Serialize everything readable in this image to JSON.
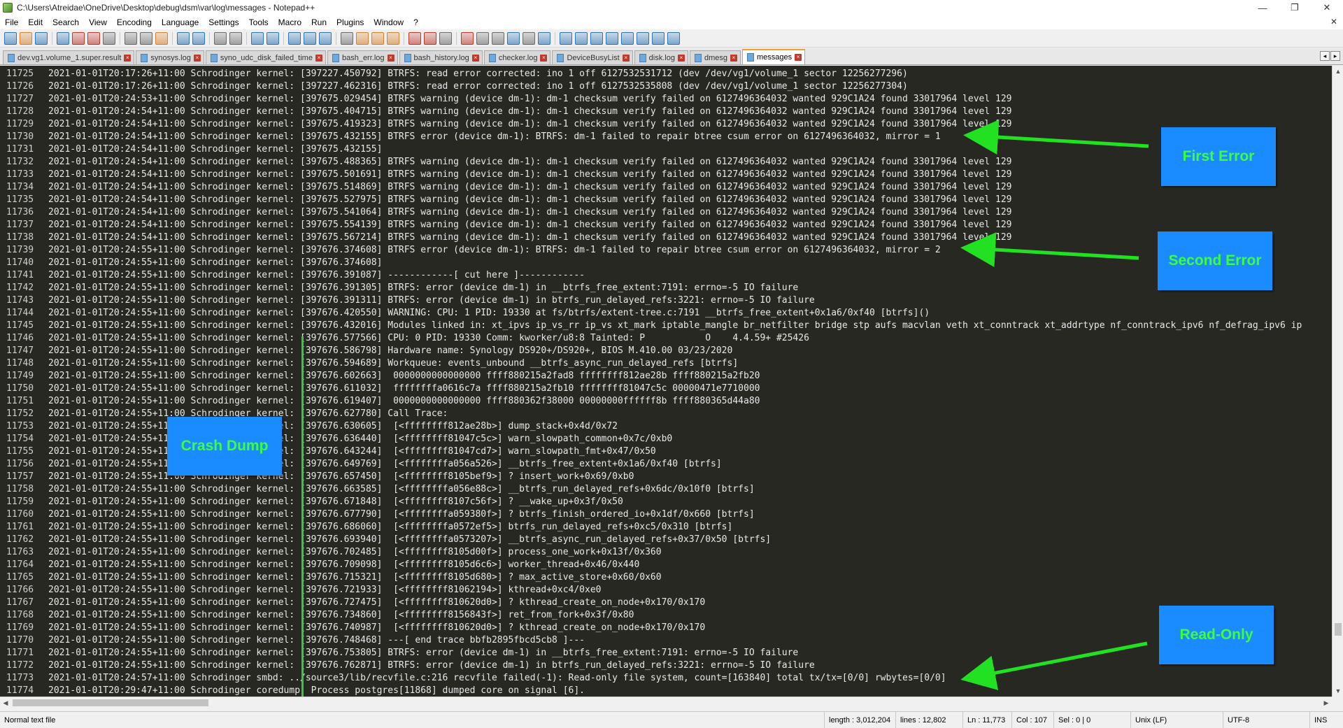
{
  "window": {
    "title": "C:\\Users\\Atreidae\\OneDrive\\Desktop\\debug\\dsm\\var\\log\\messages - Notepad++",
    "minimize": "—",
    "restore": "❐",
    "close": "✕"
  },
  "menu": {
    "items": [
      "File",
      "Edit",
      "Search",
      "View",
      "Encoding",
      "Language",
      "Settings",
      "Tools",
      "Macro",
      "Run",
      "Plugins",
      "Window",
      "?"
    ],
    "close_glyph": "✕"
  },
  "toolbar": {
    "icons": [
      "new-file",
      "open-file",
      "save",
      "save-all",
      "close",
      "close-all",
      "print",
      "cut",
      "copy",
      "paste",
      "undo",
      "redo",
      "find",
      "replace",
      "zoom-in",
      "zoom-out",
      "sync-vertical",
      "sync-horizontal",
      "word-wrap",
      "show-all-chars",
      "indent-guide",
      "udl",
      "doc-map",
      "function-list",
      "folder-as-workspace",
      "monitor",
      "record-macro",
      "stop-record",
      "play-macro",
      "run-macro-multiple",
      "save-macro",
      "launch-browser",
      "b1",
      "b2",
      "b3",
      "b4",
      "b5",
      "b6",
      "b7",
      "b8"
    ],
    "colors": {
      "primary": "#2e75b6",
      "warn": "#d9822b",
      "red": "#c0392b",
      "green": "#3a9d3a",
      "grey": "#6b6b6b"
    }
  },
  "tabs": [
    {
      "label": "dev.vg1.volume_1.super.result",
      "active": false
    },
    {
      "label": "synosys.log",
      "active": false
    },
    {
      "label": "syno_udc_disk_failed_time",
      "active": false
    },
    {
      "label": "bash_err.log",
      "active": false
    },
    {
      "label": "bash_history.log",
      "active": false
    },
    {
      "label": "checker.log",
      "active": false
    },
    {
      "label": "DeviceBusyList",
      "active": false
    },
    {
      "label": "disk.log",
      "active": false
    },
    {
      "label": "dmesg",
      "active": false
    },
    {
      "label": "messages",
      "active": true
    }
  ],
  "tab_scroll": {
    "left": "◂",
    "right": "▸"
  },
  "editor": {
    "lines": [
      {
        "num": "11725",
        "text": "2021-01-01T20:17:26+11:00 Schrodinger kernel: [397227.450792] BTRFS: read error corrected: ino 1 off 6127532531712 (dev /dev/vg1/volume_1 sector 12256277296)"
      },
      {
        "num": "11726",
        "text": "2021-01-01T20:17:26+11:00 Schrodinger kernel: [397227.462316] BTRFS: read error corrected: ino 1 off 6127532535808 (dev /dev/vg1/volume_1 sector 12256277304)"
      },
      {
        "num": "11727",
        "text": "2021-01-01T20:24:53+11:00 Schrodinger kernel: [397675.029454] BTRFS warning (device dm-1): dm-1 checksum verify failed on 6127496364032 wanted 929C1A24 found 33017964 level 129"
      },
      {
        "num": "11728",
        "text": "2021-01-01T20:24:54+11:00 Schrodinger kernel: [397675.404715] BTRFS warning (device dm-1): dm-1 checksum verify failed on 6127496364032 wanted 929C1A24 found 33017964 level 129"
      },
      {
        "num": "11729",
        "text": "2021-01-01T20:24:54+11:00 Schrodinger kernel: [397675.419323] BTRFS warning (device dm-1): dm-1 checksum verify failed on 6127496364032 wanted 929C1A24 found 33017964 level 129"
      },
      {
        "num": "11730",
        "text": "2021-01-01T20:24:54+11:00 Schrodinger kernel: [397675.432155] BTRFS error (device dm-1): BTRFS: dm-1 failed to repair btree csum error on 6127496364032, mirror = 1"
      },
      {
        "num": "11731",
        "text": "2021-01-01T20:24:54+11:00 Schrodinger kernel: [397675.432155]"
      },
      {
        "num": "11732",
        "text": "2021-01-01T20:24:54+11:00 Schrodinger kernel: [397675.488365] BTRFS warning (device dm-1): dm-1 checksum verify failed on 6127496364032 wanted 929C1A24 found 33017964 level 129"
      },
      {
        "num": "11733",
        "text": "2021-01-01T20:24:54+11:00 Schrodinger kernel: [397675.501691] BTRFS warning (device dm-1): dm-1 checksum verify failed on 6127496364032 wanted 929C1A24 found 33017964 level 129"
      },
      {
        "num": "11734",
        "text": "2021-01-01T20:24:54+11:00 Schrodinger kernel: [397675.514869] BTRFS warning (device dm-1): dm-1 checksum verify failed on 6127496364032 wanted 929C1A24 found 33017964 level 129"
      },
      {
        "num": "11735",
        "text": "2021-01-01T20:24:54+11:00 Schrodinger kernel: [397675.527975] BTRFS warning (device dm-1): dm-1 checksum verify failed on 6127496364032 wanted 929C1A24 found 33017964 level 129"
      },
      {
        "num": "11736",
        "text": "2021-01-01T20:24:54+11:00 Schrodinger kernel: [397675.541064] BTRFS warning (device dm-1): dm-1 checksum verify failed on 6127496364032 wanted 929C1A24 found 33017964 level 129"
      },
      {
        "num": "11737",
        "text": "2021-01-01T20:24:54+11:00 Schrodinger kernel: [397675.554139] BTRFS warning (device dm-1): dm-1 checksum verify failed on 6127496364032 wanted 929C1A24 found 33017964 level 129"
      },
      {
        "num": "11738",
        "text": "2021-01-01T20:24:54+11:00 Schrodinger kernel: [397675.567214] BTRFS warning (device dm-1): dm-1 checksum verify failed on 6127496364032 wanted 929C1A24 found 33017964 level 129"
      },
      {
        "num": "11739",
        "text": "2021-01-01T20:24:55+11:00 Schrodinger kernel: [397676.374608] BTRFS error (device dm-1): BTRFS: dm-1 failed to repair btree csum error on 6127496364032, mirror = 2"
      },
      {
        "num": "11740",
        "text": "2021-01-01T20:24:55+11:00 Schrodinger kernel: [397676.374608]"
      },
      {
        "num": "11741",
        "text": "2021-01-01T20:24:55+11:00 Schrodinger kernel: [397676.391087] ------------[ cut here ]------------"
      },
      {
        "num": "11742",
        "text": "2021-01-01T20:24:55+11:00 Schrodinger kernel: [397676.391305] BTRFS: error (device dm-1) in __btrfs_free_extent:7191: errno=-5 IO failure"
      },
      {
        "num": "11743",
        "text": "2021-01-01T20:24:55+11:00 Schrodinger kernel: [397676.391311] BTRFS: error (device dm-1) in btrfs_run_delayed_refs:3221: errno=-5 IO failure"
      },
      {
        "num": "11744",
        "text": "2021-01-01T20:24:55+11:00 Schrodinger kernel: [397676.420550] WARNING: CPU: 1 PID: 19330 at fs/btrfs/extent-tree.c:7191 __btrfs_free_extent+0x1a6/0xf40 [btrfs]()"
      },
      {
        "num": "11745",
        "text": "2021-01-01T20:24:55+11:00 Schrodinger kernel: [397676.432016] Modules linked in: xt_ipvs ip_vs_rr ip_vs xt_mark iptable_mangle br_netfilter bridge stp aufs macvlan veth xt_conntrack xt_addrtype nf_conntrack_ipv6 nf_defrag_ipv6 ip"
      },
      {
        "num": "11746",
        "text": "2021-01-01T20:24:55+11:00 Schrodinger kernel: [397676.577566] CPU: 0 PID: 19330 Comm: kworker/u8:8 Tainted: P           O    4.4.59+ #25426"
      },
      {
        "num": "11747",
        "text": "2021-01-01T20:24:55+11:00 Schrodinger kernel: [397676.586798] Hardware name: Synology DS920+/DS920+, BIOS M.410.00 03/23/2020"
      },
      {
        "num": "11748",
        "text": "2021-01-01T20:24:55+11:00 Schrodinger kernel: [397676.594689] Workqueue: events_unbound __btrfs_async_run_delayed_refs [btrfs]"
      },
      {
        "num": "11749",
        "text": "2021-01-01T20:24:55+11:00 Schrodinger kernel: [397676.602663]  0000000000000000 ffff880215a2fad8 ffffffff812ae28b ffff880215a2fb20"
      },
      {
        "num": "11750",
        "text": "2021-01-01T20:24:55+11:00 Schrodinger kernel: [397676.611032]  ffffffffa0616c7a ffff880215a2fb10 ffffffff81047c5c 00000471e7710000"
      },
      {
        "num": "11751",
        "text": "2021-01-01T20:24:55+11:00 Schrodinger kernel: [397676.619407]  0000000000000000 ffff880362f38000 00000000ffffff8b ffff880365d44a80"
      },
      {
        "num": "11752",
        "text": "2021-01-01T20:24:55+11:00 Schrodinger kernel: [397676.627780] Call Trace:"
      },
      {
        "num": "11753",
        "text": "2021-01-01T20:24:55+11:00 Schrodinger kernel: [397676.630605]  [<ffffffff812ae28b>] dump_stack+0x4d/0x72"
      },
      {
        "num": "11754",
        "text": "2021-01-01T20:24:55+11:00 Schrodinger kernel: [397676.636440]  [<ffffffff81047c5c>] warn_slowpath_common+0x7c/0xb0"
      },
      {
        "num": "11755",
        "text": "2021-01-01T20:24:55+11:00 Schrodinger kernel: [397676.643244]  [<ffffffff81047cd7>] warn_slowpath_fmt+0x47/0x50"
      },
      {
        "num": "11756",
        "text": "2021-01-01T20:24:55+11:00 Schrodinger kernel: [397676.649769]  [<ffffffffa056a526>] __btrfs_free_extent+0x1a6/0xf40 [btrfs]"
      },
      {
        "num": "11757",
        "text": "2021-01-01T20:24:55+11:00 Schrodinger kernel: [397676.657450]  [<ffffffff8105bef9>] ? insert_work+0x69/0xb0"
      },
      {
        "num": "11758",
        "text": "2021-01-01T20:24:55+11:00 Schrodinger kernel: [397676.663585]  [<ffffffffa056e88c>] __btrfs_run_delayed_refs+0x6dc/0x10f0 [btrfs]"
      },
      {
        "num": "11759",
        "text": "2021-01-01T20:24:55+11:00 Schrodinger kernel: [397676.671848]  [<ffffffff8107c56f>] ? __wake_up+0x3f/0x50"
      },
      {
        "num": "11760",
        "text": "2021-01-01T20:24:55+11:00 Schrodinger kernel: [397676.677790]  [<ffffffffa059380f>] ? btrfs_finish_ordered_io+0x1df/0x660 [btrfs]"
      },
      {
        "num": "11761",
        "text": "2021-01-01T20:24:55+11:00 Schrodinger kernel: [397676.686060]  [<ffffffffa0572ef5>] btrfs_run_delayed_refs+0xc5/0x310 [btrfs]"
      },
      {
        "num": "11762",
        "text": "2021-01-01T20:24:55+11:00 Schrodinger kernel: [397676.693940]  [<ffffffffa0573207>] __btrfs_async_run_delayed_refs+0x37/0x50 [btrfs]"
      },
      {
        "num": "11763",
        "text": "2021-01-01T20:24:55+11:00 Schrodinger kernel: [397676.702485]  [<ffffffff8105d00f>] process_one_work+0x13f/0x360"
      },
      {
        "num": "11764",
        "text": "2021-01-01T20:24:55+11:00 Schrodinger kernel: [397676.709098]  [<ffffffff8105d6c6>] worker_thread+0x46/0x440"
      },
      {
        "num": "11765",
        "text": "2021-01-01T20:24:55+11:00 Schrodinger kernel: [397676.715321]  [<ffffffff8105d680>] ? max_active_store+0x60/0x60"
      },
      {
        "num": "11766",
        "text": "2021-01-01T20:24:55+11:00 Schrodinger kernel: [397676.721933]  [<ffffffff81062194>] kthread+0xc4/0xe0"
      },
      {
        "num": "11767",
        "text": "2021-01-01T20:24:55+11:00 Schrodinger kernel: [397676.727475]  [<ffffffff810620d0>] ? kthread_create_on_node+0x170/0x170"
      },
      {
        "num": "11768",
        "text": "2021-01-01T20:24:55+11:00 Schrodinger kernel: [397676.734860]  [<ffffffff8156843f>] ret_from_fork+0x3f/0x80"
      },
      {
        "num": "11769",
        "text": "2021-01-01T20:24:55+11:00 Schrodinger kernel: [397676.740987]  [<ffffffff810620d0>] ? kthread_create_on_node+0x170/0x170"
      },
      {
        "num": "11770",
        "text": "2021-01-01T20:24:55+11:00 Schrodinger kernel: [397676.748468] ---[ end trace bbfb2895fbcd5cb8 ]---"
      },
      {
        "num": "11771",
        "text": "2021-01-01T20:24:55+11:00 Schrodinger kernel: [397676.753805] BTRFS: error (device dm-1) in __btrfs_free_extent:7191: errno=-5 IO failure"
      },
      {
        "num": "11772",
        "text": "2021-01-01T20:24:55+11:00 Schrodinger kernel: [397676.762871] BTRFS: error (device dm-1) in btrfs_run_delayed_refs:3221: errno=-5 IO failure"
      },
      {
        "num": "11773",
        "text": "2021-01-01T20:24:57+11:00 Schrodinger smbd: ../source3/lib/recvfile.c:216 recvfile failed(-1): Read-only file system, count=[163840] total tx/tx=[0/0] rwbytes=[0/0]"
      },
      {
        "num": "11774",
        "text": "2021-01-01T20:29:47+11:00 Schrodinger coredump: Process postgres[11868] dumped core on signal [6]."
      }
    ],
    "background": "#272822",
    "text_color": "#e8e8e8"
  },
  "annotations": [
    {
      "id": "first-error",
      "label": "First Error"
    },
    {
      "id": "second-error",
      "label": "Second Error"
    },
    {
      "id": "crash-dump",
      "label": "Crash Dump"
    },
    {
      "id": "read-only",
      "label": "Read-Only"
    }
  ],
  "annotation_colors": {
    "box": "#1a8cff",
    "text": "#3cff3c",
    "arrow": "#22e022"
  },
  "scrollbars": {
    "up": "▲",
    "down": "▼",
    "left": "◀",
    "right": "▶"
  },
  "status": {
    "file_type": "Normal text file",
    "length": "length : 3,012,204",
    "lines": "lines : 12,802",
    "ln": "Ln : 11,773",
    "col": "Col : 107",
    "sel": "Sel : 0 | 0",
    "eol": "Unix (LF)",
    "encoding": "UTF-8",
    "mode": "INS"
  }
}
